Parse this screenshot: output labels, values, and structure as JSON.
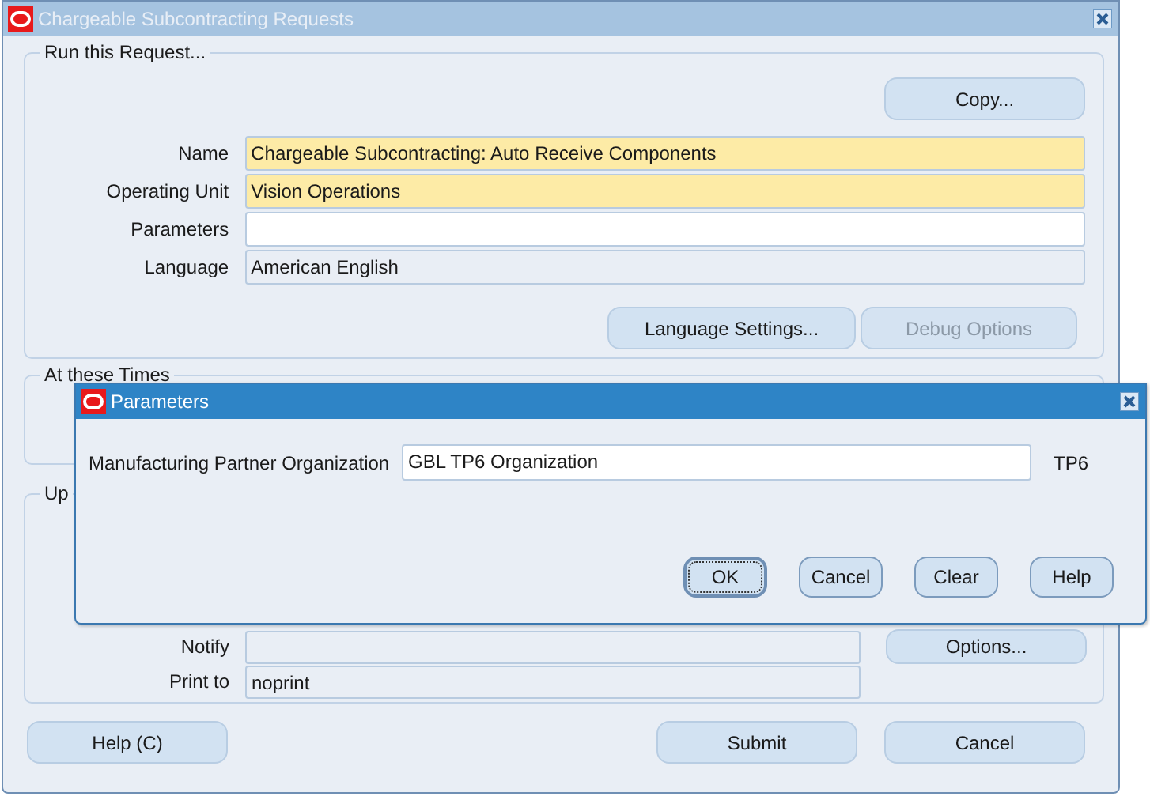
{
  "window": {
    "title": "Chargeable Subcontracting Requests",
    "active": false
  },
  "run_group": {
    "legend": "Run this Request...",
    "copy_button": {
      "label": "Copy...",
      "disabled": false
    },
    "fields": [
      {
        "label": "Name",
        "value": "Chargeable Subcontracting: Auto Receive Components",
        "kind": "required"
      },
      {
        "label": "Operating Unit",
        "value": "Vision Operations",
        "kind": "required"
      },
      {
        "label": "Parameters",
        "kind": "editable"
      },
      {
        "label": "Language",
        "value": "American English",
        "kind": "readonly"
      }
    ],
    "buttons": [
      {
        "label": "Language Settings...",
        "disabled": false
      },
      {
        "label": "Debug Options",
        "disabled": true
      }
    ]
  },
  "times_group": {
    "legend": "At these Times"
  },
  "upon_group": {
    "legend": "Up",
    "fields": [
      {
        "label": "Notify",
        "kind": "readonly"
      },
      {
        "label": "Print to",
        "value": "noprint",
        "kind": "readonly"
      }
    ],
    "options_button": {
      "label": "Options...",
      "disabled": false
    }
  },
  "footer_buttons": [
    {
      "label": "Help (C)",
      "disabled": false
    },
    {
      "label": "Submit",
      "disabled": false
    },
    {
      "label": "Cancel",
      "disabled": false
    }
  ],
  "dialog": {
    "title": "Parameters",
    "active": true,
    "field": {
      "label": "Manufacturing Partner Organization",
      "value": "GBL TP6 Organization",
      "kind": "editable"
    },
    "field_note": "TP6",
    "buttons": [
      {
        "label": "OK",
        "focused": true
      },
      {
        "label": "Cancel",
        "focused": false
      },
      {
        "label": "Clear",
        "focused": false
      },
      {
        "label": "Help",
        "focused": false
      }
    ]
  }
}
